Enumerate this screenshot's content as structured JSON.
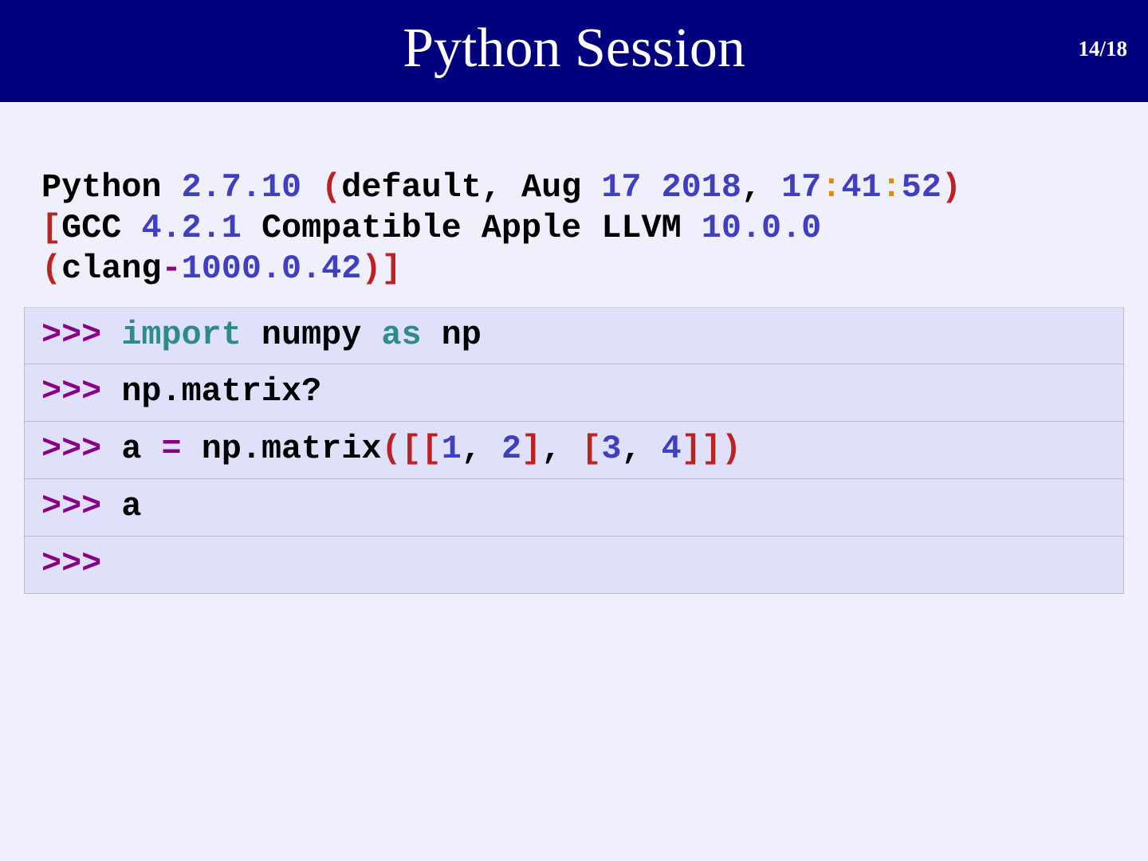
{
  "header": {
    "title": "Python Session",
    "page": "14/18"
  },
  "colors": {
    "header_bg": "#00007f",
    "k": "#000000",
    "n": "#3f3fbf",
    "p": "#bb2222",
    "o": "#e38800",
    "m": "#880088",
    "kw": "#2e8b8b"
  },
  "banner": [
    [
      {
        "t": "Python ",
        "c": "k"
      },
      {
        "t": "2.7.10 ",
        "c": "n"
      },
      {
        "t": "(",
        "c": "p"
      },
      {
        "t": "default, Aug ",
        "c": "k"
      },
      {
        "t": "17 2018",
        "c": "n"
      },
      {
        "t": ", ",
        "c": "k"
      },
      {
        "t": "17",
        "c": "n"
      },
      {
        "t": ":",
        "c": "o"
      },
      {
        "t": "41",
        "c": "n"
      },
      {
        "t": ":",
        "c": "o"
      },
      {
        "t": "52",
        "c": "n"
      },
      {
        "t": ")",
        "c": "p"
      }
    ],
    [
      {
        "t": "[",
        "c": "p"
      },
      {
        "t": "GCC ",
        "c": "k"
      },
      {
        "t": "4.2.1 ",
        "c": "n"
      },
      {
        "t": "Compatible Apple LLVM ",
        "c": "k"
      },
      {
        "t": "10.0.0",
        "c": "n"
      }
    ],
    [
      {
        "t": "(",
        "c": "p"
      },
      {
        "t": "clang",
        "c": "k"
      },
      {
        "t": "-",
        "c": "m"
      },
      {
        "t": "1000.0.42",
        "c": "n"
      },
      {
        "t": ")]",
        "c": "p"
      }
    ]
  ],
  "cells": [
    [
      {
        "t": ">>> ",
        "c": "m"
      },
      {
        "t": "import",
        "c": "kw"
      },
      {
        "t": " numpy ",
        "c": "k"
      },
      {
        "t": "as",
        "c": "kw"
      },
      {
        "t": " np",
        "c": "k"
      }
    ],
    [
      {
        "t": ">>> ",
        "c": "m"
      },
      {
        "t": "np.matrix?",
        "c": "k"
      }
    ],
    [
      {
        "t": ">>> ",
        "c": "m"
      },
      {
        "t": "a ",
        "c": "k"
      },
      {
        "t": "=",
        "c": "m"
      },
      {
        "t": " np.matrix",
        "c": "k"
      },
      {
        "t": "([[",
        "c": "p"
      },
      {
        "t": "1",
        "c": "n"
      },
      {
        "t": ", ",
        "c": "k"
      },
      {
        "t": "2",
        "c": "n"
      },
      {
        "t": "]",
        "c": "p"
      },
      {
        "t": ", ",
        "c": "k"
      },
      {
        "t": "[",
        "c": "p"
      },
      {
        "t": "3",
        "c": "n"
      },
      {
        "t": ", ",
        "c": "k"
      },
      {
        "t": "4",
        "c": "n"
      },
      {
        "t": "]])",
        "c": "p"
      }
    ],
    [
      {
        "t": ">>> ",
        "c": "m"
      },
      {
        "t": "a",
        "c": "k"
      }
    ],
    [
      {
        "t": ">>>",
        "c": "m"
      }
    ]
  ]
}
